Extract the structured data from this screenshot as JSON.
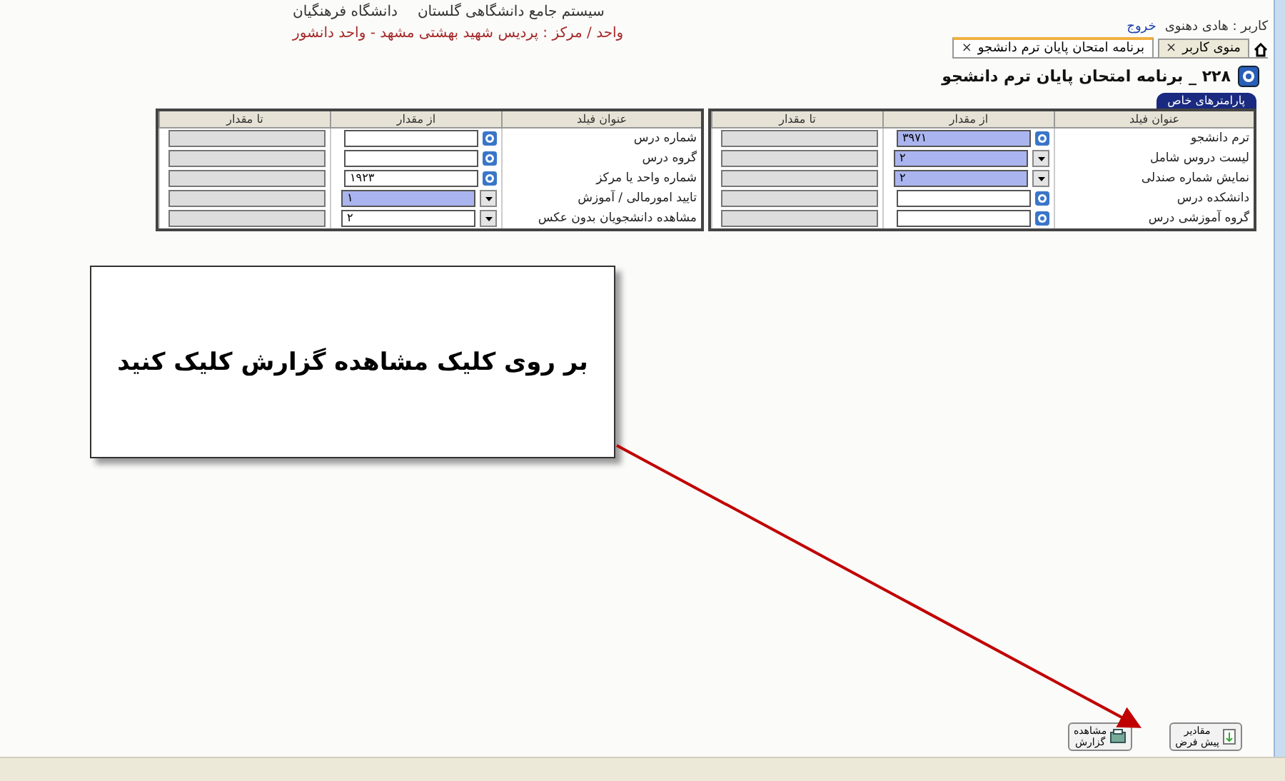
{
  "header": {
    "system": "سیستم جامع دانشگاهی گلستان",
    "university": "دانشگاه فرهنگیان",
    "unit": "واحد / مرکز : پردیس شهید بهشتی مشهد - واحد دانشور"
  },
  "user": {
    "label": "کاربر : هادی دهنوی",
    "logout": "خروج"
  },
  "tabs": [
    {
      "label": "منوی کاربر",
      "close": "×",
      "selected": false
    },
    {
      "label": "برنامه امتحان پایان ترم دانشجو",
      "close": "×",
      "selected": true
    }
  ],
  "page_title": "۲۲۸ _ برنامه امتحان پایان ترم دانشجو",
  "panel_tab": "پارامترهای خاص",
  "tables": [
    {
      "columns": [
        "عنوان فیلد",
        "از مقدار",
        "تا مقدار"
      ],
      "rows": [
        {
          "label": "ترم دانشجو",
          "kind": "lookup",
          "value": "۳۹۷۱",
          "highlighted": true
        },
        {
          "label": "لیست دروس شامل",
          "kind": "dropdown",
          "value": "۲",
          "highlighted": true
        },
        {
          "label": "نمایش شماره صندلی",
          "kind": "dropdown",
          "value": "۲",
          "highlighted": true
        },
        {
          "label": "دانشکده درس",
          "kind": "lookup",
          "highlighted": false
        },
        {
          "label": "گروه آموزشی درس",
          "kind": "lookup",
          "highlighted": false
        }
      ]
    },
    {
      "columns": [
        "عنوان فیلد",
        "از مقدار",
        "تا مقدار"
      ],
      "rows": [
        {
          "label": "شماره درس",
          "kind": "lookup",
          "highlighted": false
        },
        {
          "label": "گروه درس",
          "kind": "lookup",
          "highlighted": false
        },
        {
          "label": "شماره واحد یا مرکز",
          "kind": "lookup",
          "value": "۱۹۲۳",
          "highlighted": false
        },
        {
          "label": "تایید امورمالی / آموزش",
          "kind": "dropdown",
          "value": "۱",
          "highlighted": true
        },
        {
          "label": "مشاهده دانشجویان بدون عکس",
          "kind": "dropdown",
          "value": "۲",
          "highlighted": false
        }
      ]
    }
  ],
  "callout": "بر روی کلیک مشاهده گزارش کلیک کنید",
  "buttons": [
    {
      "kind": "defaults",
      "lines": [
        "مقادیر",
        "پیش فرض"
      ]
    },
    {
      "kind": "report",
      "lines": [
        "مشاهده",
        "گزارش"
      ]
    }
  ]
}
